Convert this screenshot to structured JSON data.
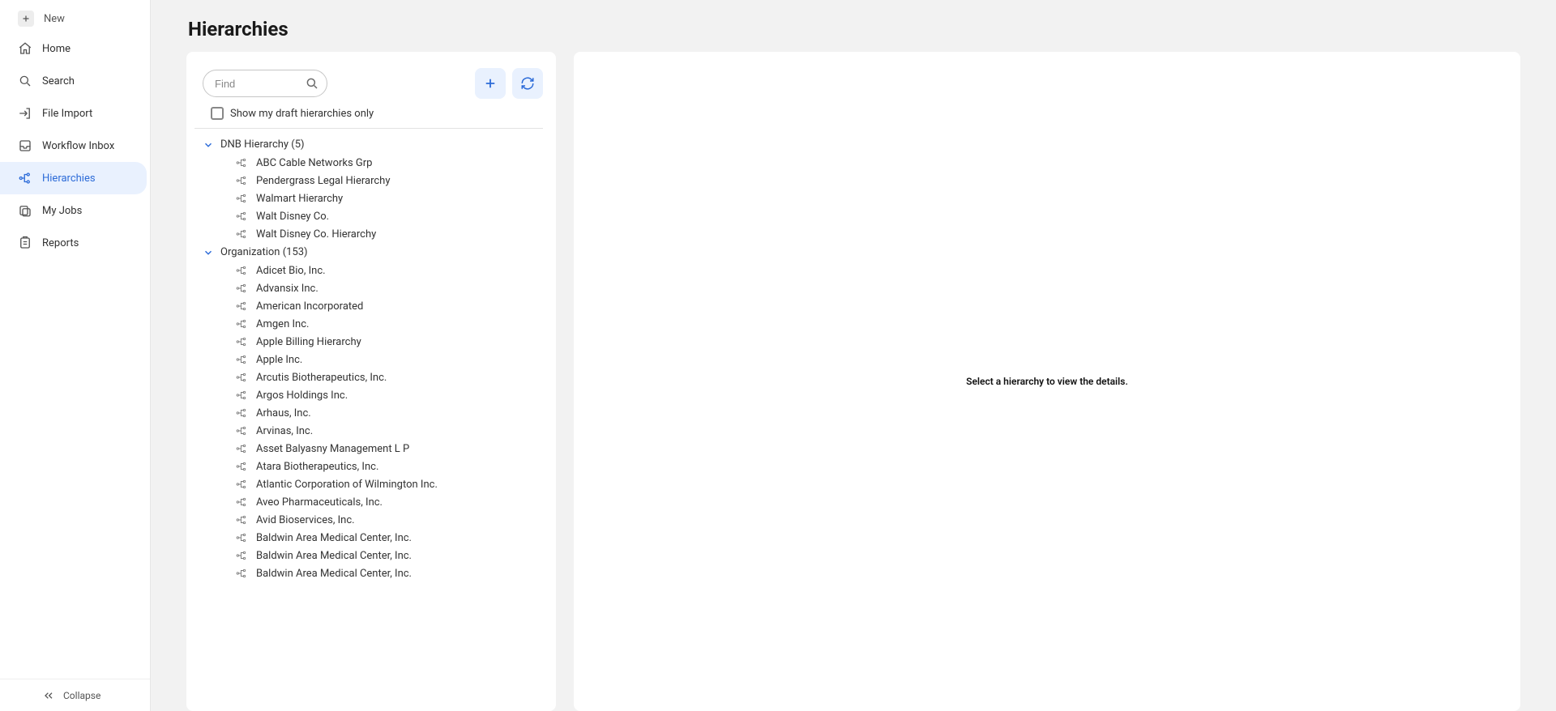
{
  "sidebar": {
    "new": "New",
    "items": [
      {
        "label": "Home"
      },
      {
        "label": "Search"
      },
      {
        "label": "File Import"
      },
      {
        "label": "Workflow Inbox"
      },
      {
        "label": "Hierarchies"
      },
      {
        "label": "My Jobs"
      },
      {
        "label": "Reports"
      }
    ],
    "collapse": "Collapse"
  },
  "page": {
    "title": "Hierarchies",
    "empty_message": "Select a hierarchy to view the details."
  },
  "panel": {
    "search_placeholder": "Find",
    "draft_only_label": "Show my draft hierarchies only"
  },
  "tree": [
    {
      "name": "DNB Hierarchy",
      "count": 5,
      "items": [
        "ABC Cable Networks Grp",
        "Pendergrass Legal Hierarchy",
        "Walmart Hierarchy",
        "Walt Disney Co.",
        "Walt Disney Co. Hierarchy"
      ]
    },
    {
      "name": "Organization",
      "count": 153,
      "items": [
        "Adicet Bio, Inc.",
        "Advansix Inc.",
        "American Incorporated",
        "Amgen Inc.",
        "Apple Billing Hierarchy",
        "Apple Inc.",
        "Arcutis Biotherapeutics, Inc.",
        "Argos Holdings Inc.",
        "Arhaus, Inc.",
        "Arvinas, Inc.",
        "Asset Balyasny Management L P",
        "Atara Biotherapeutics, Inc.",
        "Atlantic Corporation of Wilmington Inc.",
        "Aveo Pharmaceuticals, Inc.",
        "Avid Bioservices, Inc.",
        "Baldwin Area Medical Center, Inc.",
        "Baldwin Area Medical Center, Inc.",
        "Baldwin Area Medical Center, Inc."
      ]
    }
  ]
}
